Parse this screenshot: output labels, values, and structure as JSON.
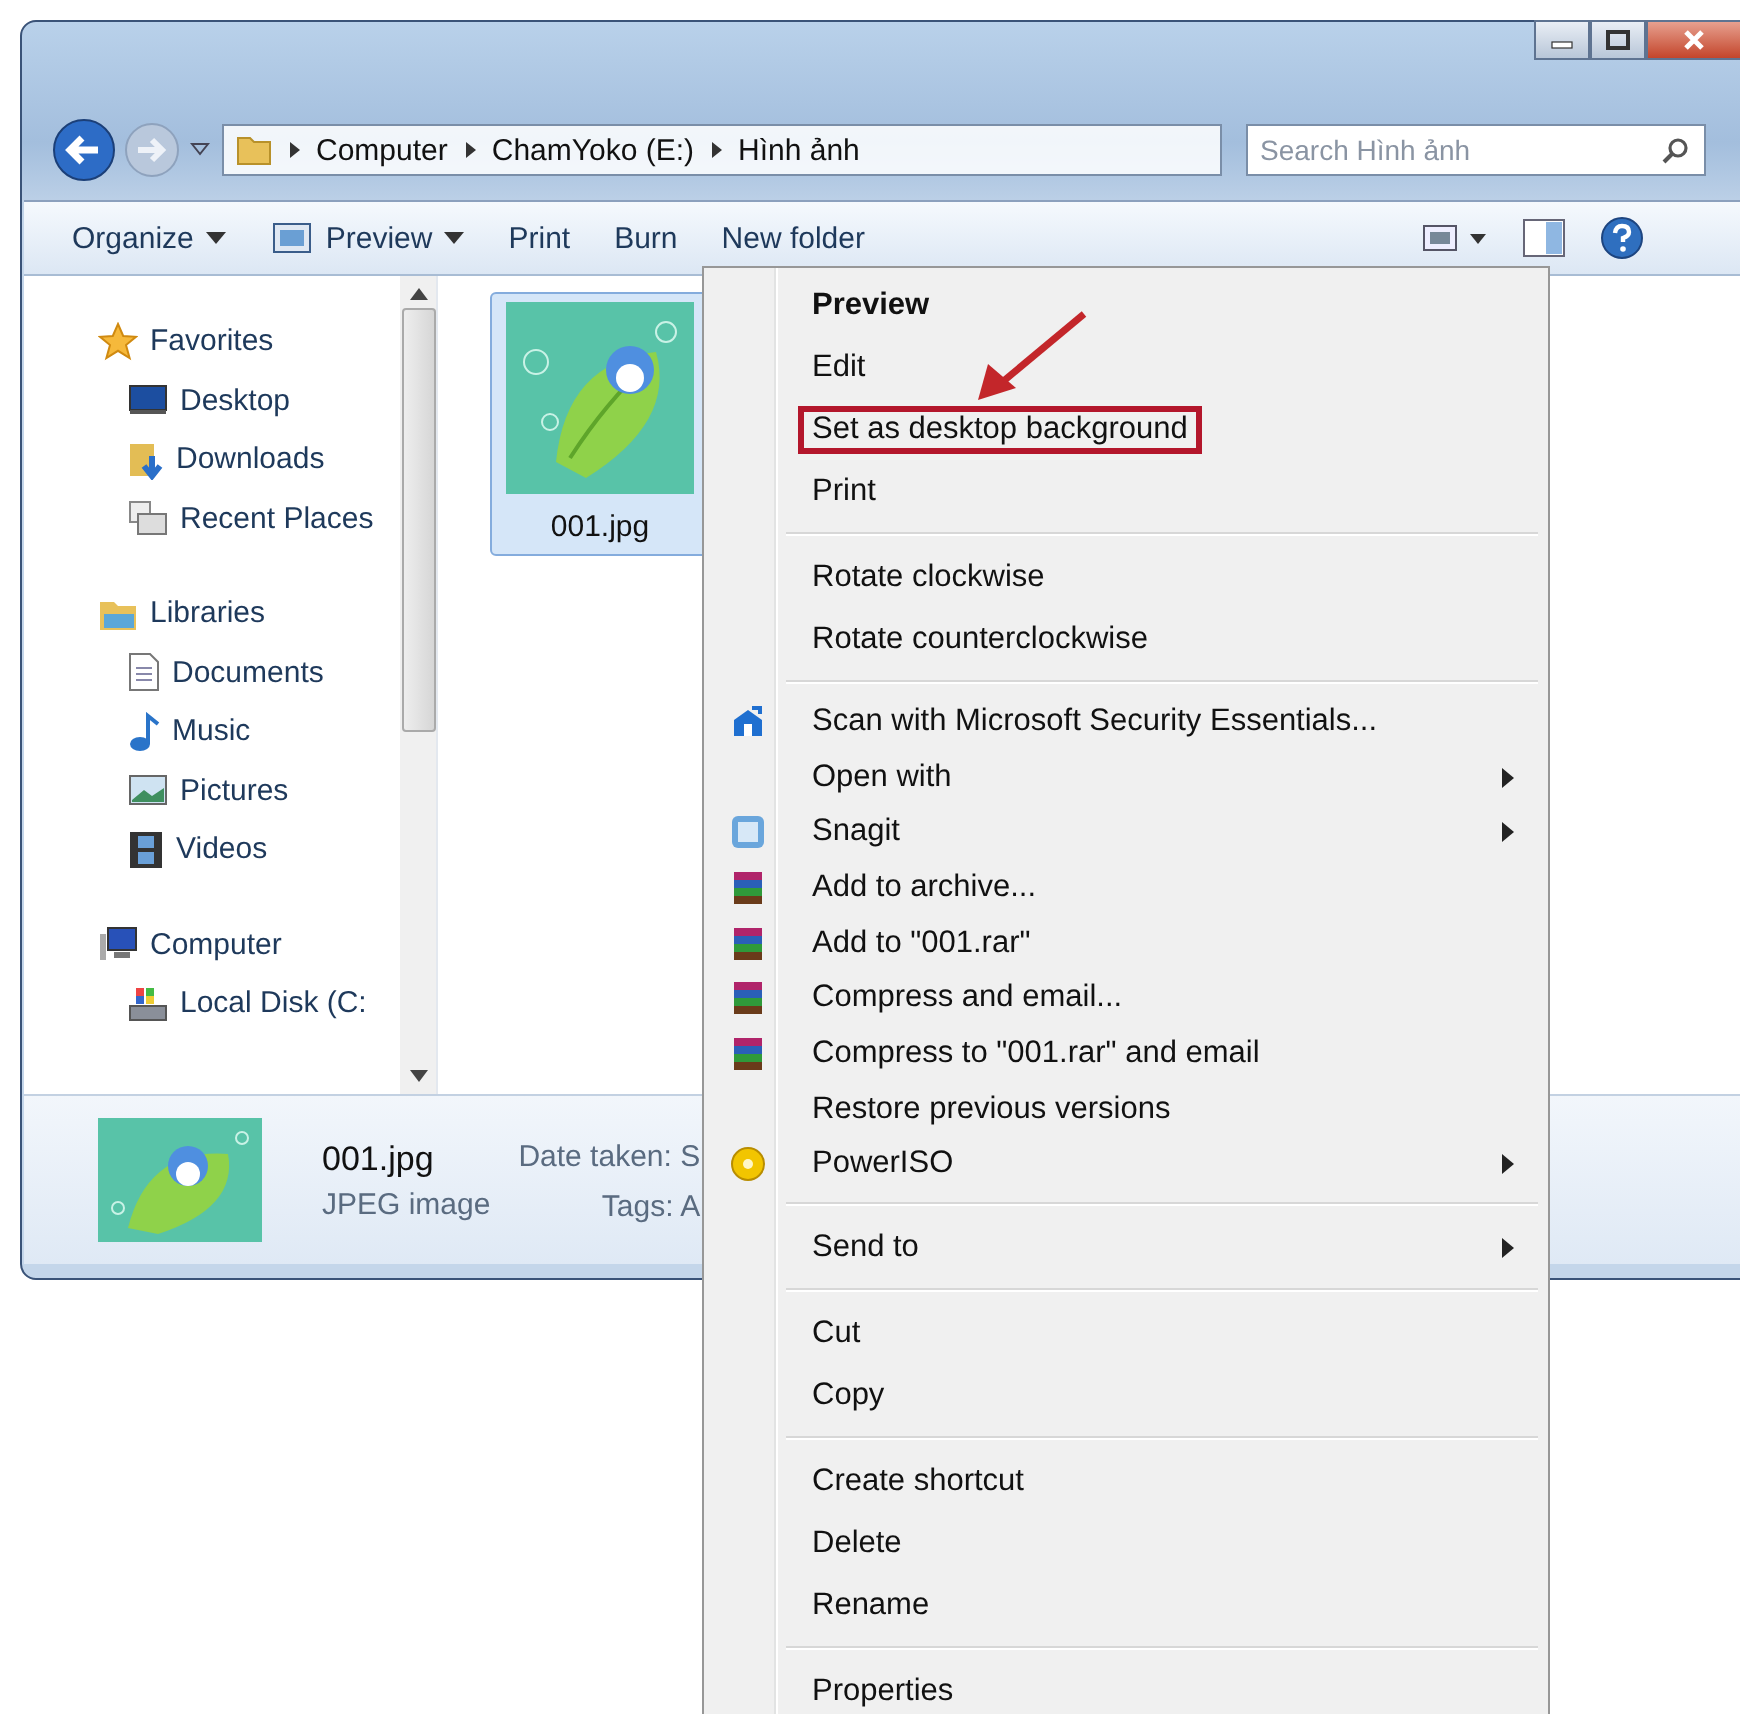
{
  "address": {
    "path": [
      "Computer",
      "ChamYoko (E:)",
      "Hình ảnh"
    ]
  },
  "search": {
    "placeholder": "Search Hình ảnh"
  },
  "toolbar": [
    {
      "label": "Organize",
      "dropdown": true
    },
    {
      "label": "Preview",
      "dropdown": true
    },
    {
      "label": "Print",
      "dropdown": false
    },
    {
      "label": "Burn",
      "dropdown": false
    },
    {
      "label": "New folder",
      "dropdown": false
    }
  ],
  "sidebar": {
    "groups": [
      {
        "label": "Favorites",
        "children": [
          {
            "label": "Desktop"
          },
          {
            "label": "Downloads"
          },
          {
            "label": "Recent Places"
          }
        ]
      },
      {
        "label": "Libraries",
        "children": [
          {
            "label": "Documents"
          },
          {
            "label": "Music"
          },
          {
            "label": "Pictures"
          },
          {
            "label": "Videos"
          }
        ]
      },
      {
        "label": "Computer",
        "children": [
          {
            "label": "Local Disk (C:"
          }
        ]
      }
    ]
  },
  "files": [
    {
      "name": "001.jpg",
      "selected": true
    }
  ],
  "details": {
    "name": "001.jpg",
    "type": "JPEG image",
    "date_label": "Date taken: S",
    "tags_label": "Tags: A"
  },
  "context_menu": {
    "groups": [
      [
        {
          "label": "Preview",
          "default": true,
          "submenu": false,
          "annotated": false
        },
        {
          "label": "Edit",
          "default": false,
          "submenu": false,
          "annotated": false
        },
        {
          "label": "Set as desktop background",
          "default": false,
          "submenu": false,
          "annotated": true
        },
        {
          "label": "Print",
          "default": false,
          "submenu": false,
          "annotated": false
        }
      ],
      [
        {
          "label": "Rotate clockwise",
          "default": false,
          "submenu": false,
          "annotated": false
        },
        {
          "label": "Rotate counterclockwise",
          "default": false,
          "submenu": false,
          "annotated": false
        }
      ],
      [
        {
          "label": "Scan with Microsoft Security Essentials...",
          "default": false,
          "submenu": false,
          "annotated": false
        },
        {
          "label": "Open with",
          "default": false,
          "submenu": true,
          "annotated": false
        },
        {
          "label": "Snagit",
          "default": false,
          "submenu": true,
          "annotated": false
        },
        {
          "label": "Add to archive...",
          "default": false,
          "submenu": false,
          "annotated": false
        },
        {
          "label": "Add to \"001.rar\"",
          "default": false,
          "submenu": false,
          "annotated": false
        },
        {
          "label": "Compress and email...",
          "default": false,
          "submenu": false,
          "annotated": false
        },
        {
          "label": "Compress to \"001.rar\" and email",
          "default": false,
          "submenu": false,
          "annotated": false
        },
        {
          "label": "Restore previous versions",
          "default": false,
          "submenu": false,
          "annotated": false
        },
        {
          "label": "PowerISO",
          "default": false,
          "submenu": true,
          "annotated": false
        }
      ],
      [
        {
          "label": "Send to",
          "default": false,
          "submenu": true,
          "annotated": false
        }
      ],
      [
        {
          "label": "Cut",
          "default": false,
          "submenu": false,
          "annotated": false
        },
        {
          "label": "Copy",
          "default": false,
          "submenu": false,
          "annotated": false
        }
      ],
      [
        {
          "label": "Create shortcut",
          "default": false,
          "submenu": false,
          "annotated": false
        },
        {
          "label": "Delete",
          "default": false,
          "submenu": false,
          "annotated": false
        },
        {
          "label": "Rename",
          "default": false,
          "submenu": false,
          "annotated": false
        }
      ],
      [
        {
          "label": "Properties",
          "default": false,
          "submenu": false,
          "annotated": false
        }
      ]
    ]
  }
}
